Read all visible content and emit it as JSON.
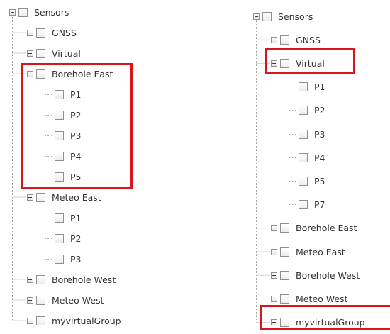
{
  "left_tree": {
    "root": "Sensors",
    "rows": [
      {
        "label": "Sensors",
        "level": 0,
        "expander": "expanded"
      },
      {
        "label": "GNSS",
        "level": 1,
        "expander": "collapsed"
      },
      {
        "label": "Virtual",
        "level": 1,
        "expander": "collapsed"
      },
      {
        "label": "Borehole East",
        "level": 1,
        "expander": "expanded"
      },
      {
        "label": "P1",
        "level": 2,
        "expander": "none"
      },
      {
        "label": "P2",
        "level": 2,
        "expander": "none"
      },
      {
        "label": "P3",
        "level": 2,
        "expander": "none"
      },
      {
        "label": "P4",
        "level": 2,
        "expander": "none"
      },
      {
        "label": "P5",
        "level": 2,
        "expander": "none"
      },
      {
        "label": "Meteo East",
        "level": 1,
        "expander": "expanded"
      },
      {
        "label": "P1",
        "level": 2,
        "expander": "none"
      },
      {
        "label": "P2",
        "level": 2,
        "expander": "none"
      },
      {
        "label": "P3",
        "level": 2,
        "expander": "none"
      },
      {
        "label": "Borehole West",
        "level": 1,
        "expander": "collapsed"
      },
      {
        "label": "Meteo West",
        "level": 1,
        "expander": "collapsed"
      },
      {
        "label": "myvirtualGroup",
        "level": 1,
        "expander": "collapsed"
      }
    ]
  },
  "right_tree": {
    "root": "Sensors",
    "rows": [
      {
        "label": "Sensors",
        "level": 0,
        "expander": "expanded"
      },
      {
        "label": "GNSS",
        "level": 1,
        "expander": "collapsed"
      },
      {
        "label": "Virtual",
        "level": 1,
        "expander": "expanded"
      },
      {
        "label": "P1",
        "level": 2,
        "expander": "none"
      },
      {
        "label": "P2",
        "level": 2,
        "expander": "none"
      },
      {
        "label": "P3",
        "level": 2,
        "expander": "none"
      },
      {
        "label": "P4",
        "level": 2,
        "expander": "none"
      },
      {
        "label": "P5",
        "level": 2,
        "expander": "none"
      },
      {
        "label": "P7",
        "level": 2,
        "expander": "none"
      },
      {
        "label": "Borehole East",
        "level": 1,
        "expander": "collapsed"
      },
      {
        "label": "Meteo East",
        "level": 1,
        "expander": "collapsed"
      },
      {
        "label": "Borehole West",
        "level": 1,
        "expander": "collapsed"
      },
      {
        "label": "Meteo West",
        "level": 1,
        "expander": "collapsed"
      },
      {
        "label": "myvirtualGroup",
        "level": 1,
        "expander": "collapsed"
      }
    ]
  },
  "colors": {
    "highlight": "#d9151c",
    "text": "#333333",
    "tree_line": "#a8a8a8"
  },
  "icons": {
    "expanded": "minus-expander-icon",
    "collapsed": "plus-expander-icon",
    "checkbox": "checkbox-icon"
  }
}
